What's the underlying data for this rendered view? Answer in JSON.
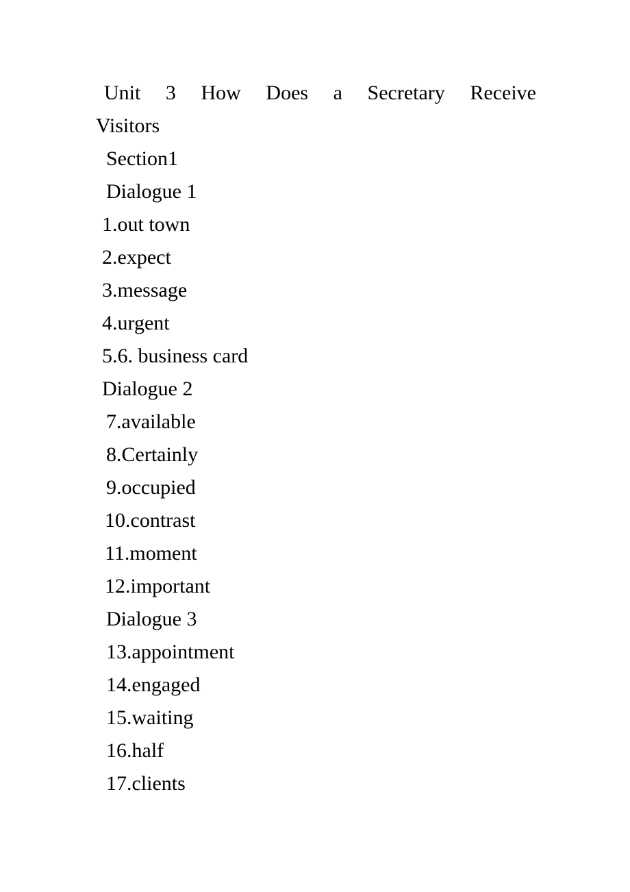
{
  "document": {
    "title_line_1": "Unit 3 How Does a Secretary Receive",
    "title_line_2": "Visitors",
    "section_label": "Section1",
    "blocks": [
      {
        "heading": "Dialogue 1",
        "items": [
          "1.out town",
          "2.expect",
          "3.message",
          "4.urgent",
          "5.6. business card"
        ]
      },
      {
        "heading": "Dialogue 2",
        "items": [
          "7.available",
          "8.Certainly",
          "9.occupied",
          "10.contrast",
          "11.moment",
          "12.important"
        ]
      },
      {
        "heading": "Dialogue 3",
        "items": [
          "13.appointment",
          "14.engaged",
          "15.waiting",
          "16.half",
          "17.clients"
        ]
      }
    ]
  }
}
